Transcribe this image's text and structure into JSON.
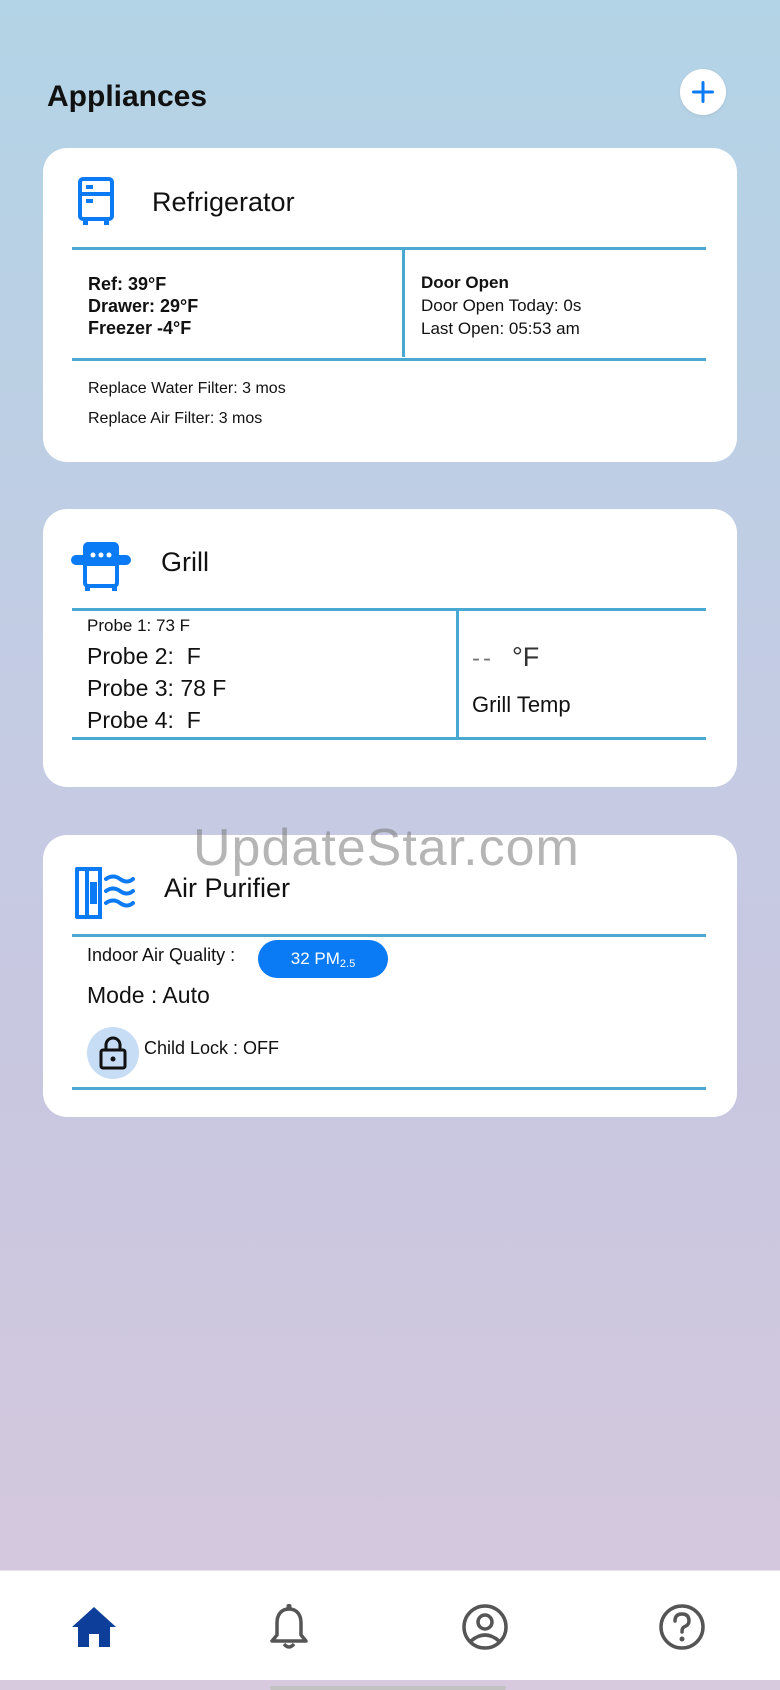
{
  "header": {
    "title": "Appliances",
    "add_icon": "plus-icon"
  },
  "refrigerator": {
    "name": "Refrigerator",
    "icon": "refrigerator-icon",
    "temps": {
      "ref": "Ref: 39°F",
      "drawer": "Drawer: 29°F",
      "freezer": "Freezer -4°F"
    },
    "door": {
      "status": "Door Open",
      "today": "Door Open Today: 0s",
      "last_open": "Last Open: 05:53 am"
    },
    "filters": {
      "water": "Replace Water Filter: 3 mos",
      "air": "Replace Air Filter: 3 mos"
    }
  },
  "grill": {
    "name": "Grill",
    "icon": "grill-icon",
    "probes": [
      "Probe 1: 73 F",
      "Probe 2:  F",
      "Probe 3: 78 F",
      "Probe 4:  F"
    ],
    "temp_value": "--",
    "temp_unit": "°F",
    "temp_label": "Grill Temp"
  },
  "air_purifier": {
    "name": "Air Purifier",
    "icon": "air-purifier-icon",
    "air_quality_label": "Indoor Air Quality :",
    "air_quality_value": "32 PM",
    "air_quality_sub": "2.5",
    "mode": "Mode : Auto",
    "child_lock": "Child Lock : OFF",
    "lock_icon": "lock-icon"
  },
  "watermark": "UpdateStar.com",
  "bottom_nav": {
    "items": [
      {
        "name": "home",
        "icon": "home-icon",
        "active": true
      },
      {
        "name": "notifications",
        "icon": "bell-icon",
        "active": false
      },
      {
        "name": "account",
        "icon": "account-icon",
        "active": false
      },
      {
        "name": "help",
        "icon": "help-icon",
        "active": false
      }
    ]
  },
  "colors": {
    "accent": "#0a7af5",
    "divider": "#4aa9d3",
    "nav_active": "#0d3e9a",
    "nav_inactive": "#555555"
  }
}
